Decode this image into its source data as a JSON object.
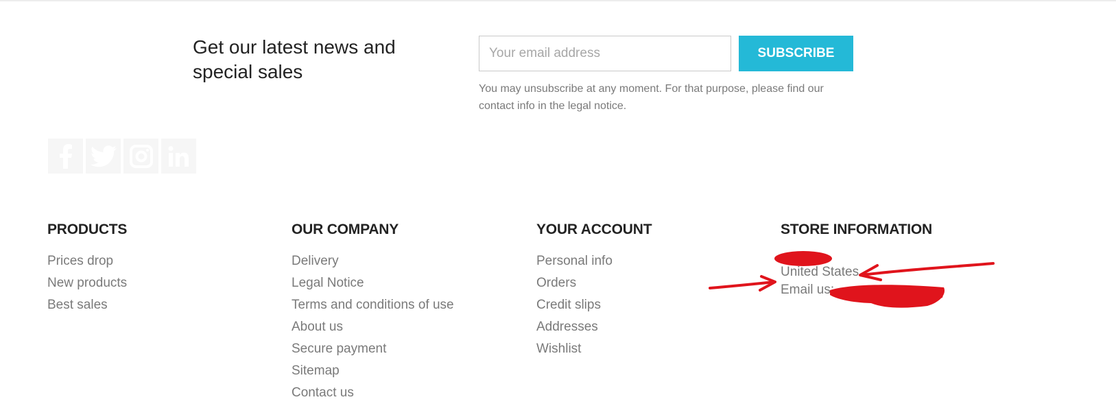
{
  "newsletter": {
    "title": "Get our latest news and special sales",
    "email_placeholder": "Your email address",
    "subscribe_label": "SUBSCRIBE",
    "legal_note": "You may unsubscribe at any moment. For that purpose, please find our contact info in the legal notice."
  },
  "social": {
    "icons": [
      "facebook-icon",
      "twitter-icon",
      "instagram-icon",
      "linkedin-icon"
    ]
  },
  "footer": {
    "products": {
      "heading": "PRODUCTS",
      "links": [
        "Prices drop",
        "New products",
        "Best sales"
      ]
    },
    "company": {
      "heading": "OUR COMPANY",
      "links": [
        "Delivery",
        "Legal Notice",
        "Terms and conditions of use",
        "About us",
        "Secure payment",
        "Sitemap",
        "Contact us"
      ]
    },
    "account": {
      "heading": "YOUR ACCOUNT",
      "links": [
        "Personal info",
        "Orders",
        "Credit slips",
        "Addresses",
        "Wishlist"
      ]
    },
    "store": {
      "heading": "STORE INFORMATION",
      "country": "United States",
      "email_label": "Email us:"
    }
  },
  "colors": {
    "accent": "#24b9d7",
    "heading_text": "#232323",
    "link_text": "#7a7a7a",
    "annotation_red": "#e0141c"
  }
}
